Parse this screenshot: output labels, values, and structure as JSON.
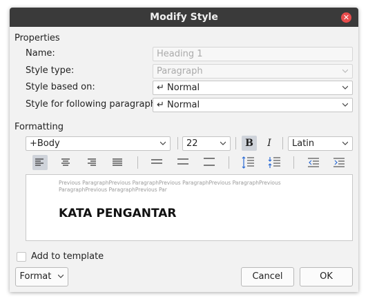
{
  "dialog": {
    "title": "Modify Style"
  },
  "properties": {
    "section_label": "Properties",
    "name": {
      "label": "Name:",
      "value": "Heading 1"
    },
    "style_type": {
      "label": "Style type:",
      "value": "Paragraph"
    },
    "based_on": {
      "label": "Style based on:",
      "value": "↵ Normal"
    },
    "following": {
      "label": "Style for following paragraph:",
      "value": "↵ Normal"
    }
  },
  "formatting": {
    "section_label": "Formatting",
    "font": "+Body",
    "size": "22",
    "script": "Latin",
    "bold_label": "B",
    "italic_label": "I"
  },
  "preview": {
    "prev_line1": "Previous ParagraphPrevious ParagraphPrevious ParagraphPrevious ParagraphPrevious",
    "prev_line2": "ParagraphPrevious ParagraphPrevious Par",
    "heading": "KATA PENGANTAR"
  },
  "add_to_template": {
    "label": "Add to template",
    "checked": false
  },
  "buttons": {
    "format": "Format",
    "cancel": "Cancel",
    "ok": "OK"
  }
}
